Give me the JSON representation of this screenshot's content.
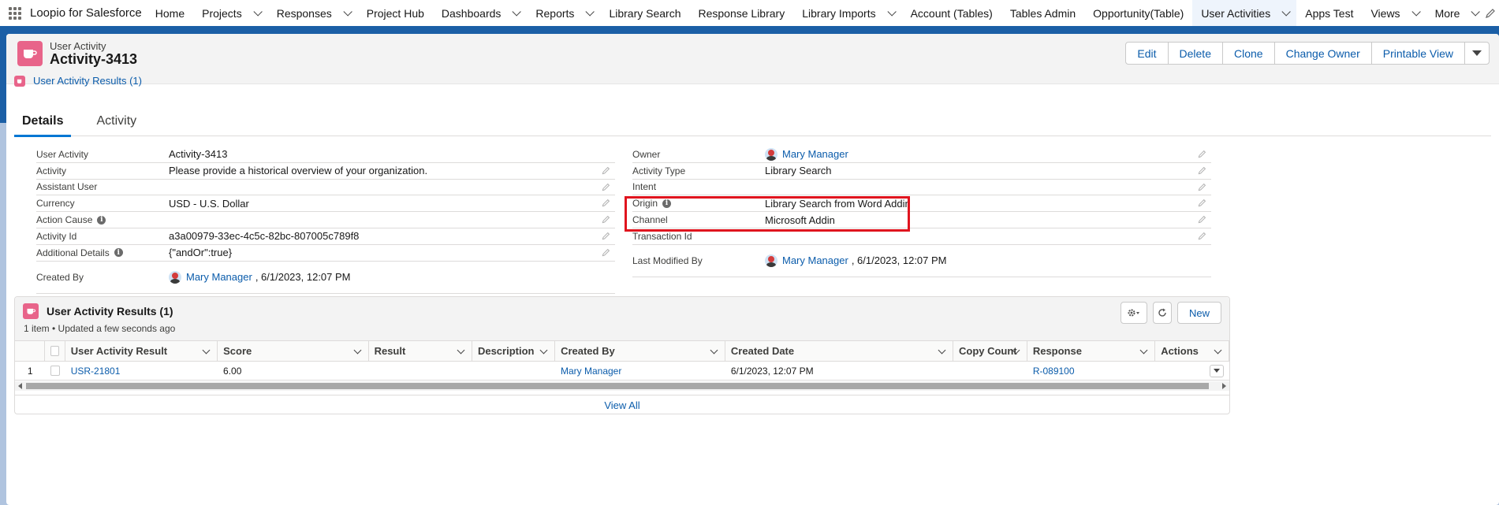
{
  "nav": {
    "app_name": "Loopio for Salesforce",
    "items": [
      {
        "label": "Home",
        "dropdown": false,
        "active": false
      },
      {
        "label": "Projects",
        "dropdown": true,
        "active": false
      },
      {
        "label": "Responses",
        "dropdown": true,
        "active": false
      },
      {
        "label": "Project Hub",
        "dropdown": false,
        "active": false
      },
      {
        "label": "Dashboards",
        "dropdown": true,
        "active": false
      },
      {
        "label": "Reports",
        "dropdown": true,
        "active": false
      },
      {
        "label": "Library Search",
        "dropdown": false,
        "active": false
      },
      {
        "label": "Response Library",
        "dropdown": false,
        "active": false
      },
      {
        "label": "Library Imports",
        "dropdown": true,
        "active": false
      },
      {
        "label": "Account (Tables)",
        "dropdown": false,
        "active": false
      },
      {
        "label": "Tables Admin",
        "dropdown": false,
        "active": false
      },
      {
        "label": "Opportunity(Table)",
        "dropdown": false,
        "active": false
      },
      {
        "label": "User Activities",
        "dropdown": true,
        "active": true
      },
      {
        "label": "Apps Test",
        "dropdown": false,
        "active": false
      },
      {
        "label": "Views",
        "dropdown": true,
        "active": false
      },
      {
        "label": "More",
        "dropdown": true,
        "active": false
      }
    ]
  },
  "header": {
    "object_label": "User Activity",
    "record_name": "Activity-3413",
    "buttons": [
      "Edit",
      "Delete",
      "Clone",
      "Change Owner",
      "Printable View"
    ],
    "related_link": "User Activity Results (1)"
  },
  "tabs": [
    "Details",
    "Activity"
  ],
  "details": {
    "left": [
      {
        "label": "User Activity",
        "value": "Activity-3413",
        "editable": false,
        "info": false,
        "type": "text"
      },
      {
        "label": "Activity",
        "value": "Please provide a historical overview of your organization.",
        "editable": true,
        "info": false,
        "type": "text"
      },
      {
        "label": "Assistant User",
        "value": "",
        "editable": true,
        "info": false,
        "type": "text"
      },
      {
        "label": "Currency",
        "value": "USD - U.S. Dollar",
        "editable": true,
        "info": false,
        "type": "text"
      },
      {
        "label": "Action Cause",
        "value": "",
        "editable": true,
        "info": true,
        "type": "text"
      },
      {
        "label": "Activity Id",
        "value": "a3a00979-33ec-4c5c-82bc-807005c789f8",
        "editable": true,
        "info": false,
        "type": "text"
      },
      {
        "label": "Additional Details",
        "value": "{\"andOr\":true}",
        "editable": true,
        "info": true,
        "type": "text"
      },
      {
        "label": "Created By",
        "value": "Mary Manager",
        "suffix": ", 6/1/2023, 12:07 PM",
        "editable": false,
        "info": false,
        "type": "user"
      }
    ],
    "right": [
      {
        "label": "Owner",
        "value": "Mary Manager",
        "editable": true,
        "info": false,
        "type": "user"
      },
      {
        "label": "Activity Type",
        "value": "Library Search",
        "editable": true,
        "info": false,
        "type": "text"
      },
      {
        "label": "Intent",
        "value": "",
        "editable": true,
        "info": false,
        "type": "text"
      },
      {
        "label": "Origin",
        "value": "Library Search from Word Addin",
        "editable": true,
        "info": true,
        "type": "text"
      },
      {
        "label": "Channel",
        "value": "Microsoft Addin",
        "editable": true,
        "info": false,
        "type": "text"
      },
      {
        "label": "Transaction Id",
        "value": "",
        "editable": true,
        "info": false,
        "type": "text"
      },
      {
        "label": "",
        "value": "",
        "editable": false,
        "info": false,
        "type": "blank"
      },
      {
        "label": "Last Modified By",
        "value": "Mary Manager",
        "suffix": ", 6/1/2023, 12:07 PM",
        "editable": false,
        "info": false,
        "type": "user"
      }
    ]
  },
  "related": {
    "title": "User Activity Results (1)",
    "subtitle": "1 item • Updated a few seconds ago",
    "new_label": "New",
    "columns": [
      "User Activity Result",
      "Score",
      "Result",
      "Description",
      "Created By",
      "Created Date",
      "Copy Count",
      "Response",
      "Actions"
    ],
    "rows": [
      {
        "num": "1",
        "cells": [
          "USR-21801",
          "6.00",
          "",
          "",
          "Mary Manager",
          "6/1/2023, 12:07 PM",
          "",
          "R-089100",
          ""
        ]
      }
    ],
    "view_all": "View All"
  }
}
